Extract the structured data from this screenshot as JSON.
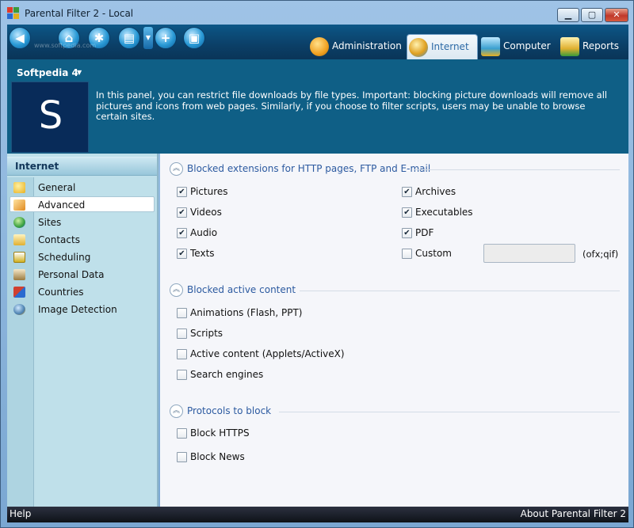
{
  "window": {
    "title": "Parental Filter 2 - Local",
    "minimize_glyph": "▁",
    "maximize_glyph": "▢",
    "close_glyph": "✕"
  },
  "toolbar": {
    "watermark": "www.softpedia.com",
    "buttons": [
      {
        "name": "back-icon",
        "glyph": "◀"
      },
      {
        "name": "home-icon",
        "glyph": "⌂"
      },
      {
        "name": "network-icon",
        "glyph": "✱"
      },
      {
        "name": "save-copy-icon",
        "glyph": "▤"
      },
      {
        "name": "add-icon",
        "glyph": "+"
      },
      {
        "name": "save-icon",
        "glyph": "▣"
      }
    ],
    "dropdown_glyph": "▼",
    "tabs": [
      {
        "label": "Administration",
        "icon": "gear-icon",
        "color": "#f0a020"
      },
      {
        "label": "Internet",
        "icon": "globe-icon",
        "color": "#e0a020"
      },
      {
        "label": "Computer",
        "icon": "computer-icon",
        "color": "#3aa0d0"
      },
      {
        "label": "Reports",
        "icon": "reports-icon",
        "color": "#e0b030"
      }
    ],
    "active_tab": "Internet"
  },
  "header": {
    "profile_name": "Softpedia 4",
    "profile_caret": "▼",
    "profile_logo_letter": "S",
    "description": "In this panel, you can restrict file downloads by file types. Important: blocking picture downloads will remove all pictures and icons from web pages. Similarly, if you choose to filter scripts, users may be unable to browse certain sites."
  },
  "sidebar": {
    "header": "Internet",
    "items": [
      {
        "label": "General",
        "icon": "general-icon",
        "color": "#e8b020"
      },
      {
        "label": "Advanced",
        "icon": "advanced-icon",
        "color": "#e08a20"
      },
      {
        "label": "Sites",
        "icon": "sites-icon",
        "color": "#3aa040"
      },
      {
        "label": "Contacts",
        "icon": "contacts-icon",
        "color": "#e0b030"
      },
      {
        "label": "Scheduling",
        "icon": "scheduling-icon",
        "color": "#d0b020"
      },
      {
        "label": "Personal Data",
        "icon": "personal-data-icon",
        "color": "#9a7a40"
      },
      {
        "label": "Countries",
        "icon": "countries-icon",
        "color": "#d04030"
      },
      {
        "label": "Image Detection",
        "icon": "image-detection-icon",
        "color": "#4a80b0"
      }
    ],
    "selected": "Advanced"
  },
  "sections": {
    "extensions": {
      "title": "Blocked extensions for HTTP pages, FTP and E-mail",
      "chevron": "︽",
      "left": [
        {
          "label": "Pictures",
          "checked": true
        },
        {
          "label": "Videos",
          "checked": true
        },
        {
          "label": "Audio",
          "checked": true
        },
        {
          "label": "Texts",
          "checked": true
        }
      ],
      "right": [
        {
          "label": "Archives",
          "checked": true
        },
        {
          "label": "Executables",
          "checked": true
        },
        {
          "label": "PDF",
          "checked": true
        },
        {
          "label": "Custom",
          "checked": false
        }
      ],
      "custom_value": "",
      "custom_hint": "(ofx;qif)"
    },
    "active_content": {
      "title": "Blocked active content",
      "chevron": "︽",
      "items": [
        {
          "label": "Animations (Flash, PPT)",
          "checked": false
        },
        {
          "label": "Scripts",
          "checked": false
        },
        {
          "label": "Active content (Applets/ActiveX)",
          "checked": false
        },
        {
          "label": "Search engines",
          "checked": false
        }
      ]
    },
    "protocols": {
      "title": "Protocols to block",
      "chevron": "︽",
      "items": [
        {
          "label": "Block HTTPS",
          "checked": false
        },
        {
          "label": "Block News",
          "checked": false
        }
      ]
    }
  },
  "status": {
    "help": "Help",
    "about": "About Parental Filter 2"
  },
  "check_glyph": "✔"
}
